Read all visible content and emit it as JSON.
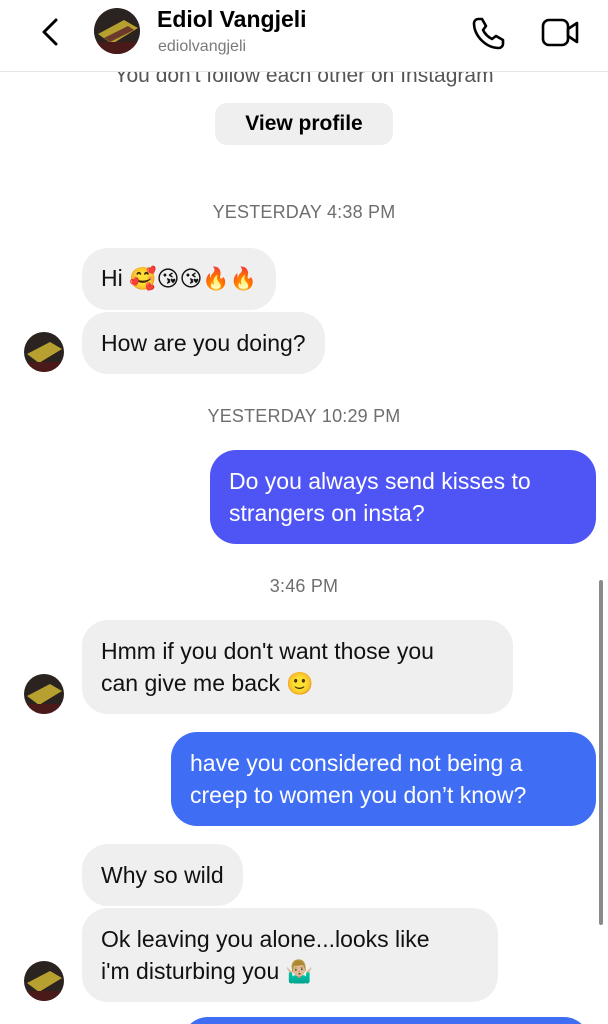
{
  "header": {
    "name": "Ediol Vangjeli",
    "username": "ediolvangjeli"
  },
  "profile": {
    "notice": "You don't follow each other on Instagram",
    "view_profile_label": "View profile"
  },
  "timestamps": [
    "YESTERDAY 4:38 PM",
    "YESTERDAY 10:29 PM",
    "3:46 PM"
  ],
  "messages": [
    {
      "from": "them",
      "text": "Hi",
      "emoji": "🥰😘😘🔥🔥"
    },
    {
      "from": "them",
      "text": "How are you doing?"
    },
    {
      "from": "me",
      "line1": "Do you always send kisses to",
      "line2": "strangers on insta?"
    },
    {
      "from": "them",
      "line1": "Hmm if you don't want those you",
      "line2": "can give me back",
      "emoji": "🙂"
    },
    {
      "from": "me",
      "line1": "have you considered not being a",
      "line2": "creep to women you don’t know?"
    },
    {
      "from": "them",
      "text": "Why so wild"
    },
    {
      "from": "them",
      "line1": "Ok leaving you alone...looks like",
      "line2": "i'm disturbing you",
      "emoji": "🤷🏼‍♂️"
    }
  ],
  "colors": {
    "outgoing_bubble": "#4f55f5",
    "outgoing_bubble_2": "#3f6ef5",
    "incoming_bubble": "#efefef"
  },
  "icons": [
    "back-arrow-icon",
    "phone-icon",
    "video-camera-icon"
  ]
}
